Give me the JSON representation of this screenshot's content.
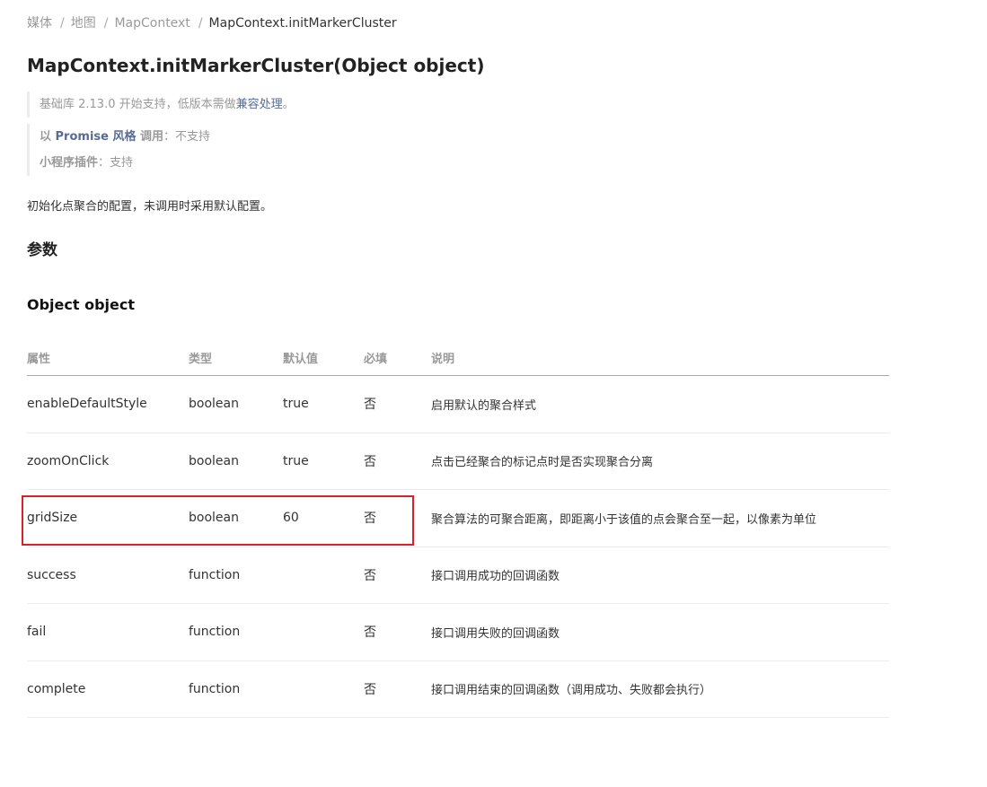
{
  "breadcrumb": [
    "媒体",
    "地图",
    "MapContext",
    "MapContext.initMarkerCluster"
  ],
  "title": "MapContext.initMarkerCluster(Object object)",
  "notes": {
    "version_prefix": "基础库 2.13.0 开始支持，低版本需做",
    "version_link": "兼容处理",
    "version_suffix": "。",
    "promise_pre": "以 ",
    "promise_link": "Promise 风格",
    "promise_mid": " 调用",
    "promise_value": "：不支持",
    "plugin_label": "小程序插件",
    "plugin_value": "：支持"
  },
  "description": "初始化点聚合的配置，未调用时采用默认配置。",
  "section_params": "参数",
  "section_object": "Object object",
  "table": {
    "headers": [
      "属性",
      "类型",
      "默认值",
      "必填",
      "说明"
    ],
    "rows": [
      {
        "name": "enableDefaultStyle",
        "type": "boolean",
        "default": "true",
        "required": "否",
        "desc": "启用默认的聚合样式"
      },
      {
        "name": "zoomOnClick",
        "type": "boolean",
        "default": "true",
        "required": "否",
        "desc": "点击已经聚合的标记点时是否实现聚合分离"
      },
      {
        "name": "gridSize",
        "type": "boolean",
        "default": "60",
        "required": "否",
        "desc": "聚合算法的可聚合距离，即距离小于该值的点会聚合至一起，以像素为单位"
      },
      {
        "name": "success",
        "type": "function",
        "default": "",
        "required": "否",
        "desc": "接口调用成功的回调函数"
      },
      {
        "name": "fail",
        "type": "function",
        "default": "",
        "required": "否",
        "desc": "接口调用失败的回调函数"
      },
      {
        "name": "complete",
        "type": "function",
        "default": "",
        "required": "否",
        "desc": "接口调用结束的回调函数（调用成功、失败都会执行）"
      }
    ]
  },
  "colors": {
    "link": "#576b95",
    "highlight": "#d9212a",
    "muted": "#999999",
    "text": "#333333"
  }
}
